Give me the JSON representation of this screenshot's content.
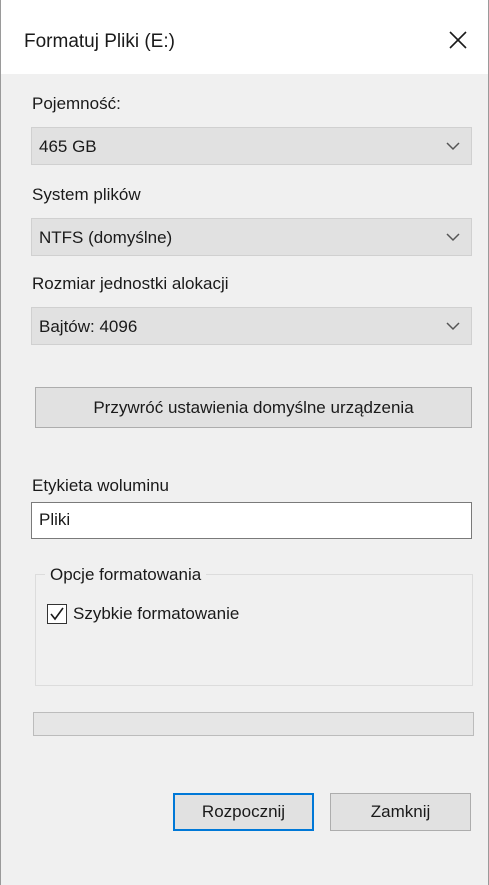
{
  "window": {
    "title": "Formatuj Pliki (E:)",
    "close_icon": "close-icon"
  },
  "capacity": {
    "label": "Pojemność:",
    "value": "465 GB"
  },
  "file_system": {
    "label": "System plików",
    "value": "NTFS (domyślne)"
  },
  "allocation_unit": {
    "label": "Rozmiar jednostki alokacji",
    "value": "Bajtów: 4096"
  },
  "restore_defaults_button": "Przywróć ustawienia domyślne urządzenia",
  "volume_label": {
    "label": "Etykieta woluminu",
    "value": "Pliki"
  },
  "format_options": {
    "legend": "Opcje formatowania",
    "quick_format_label": "Szybkie formatowanie",
    "quick_format_checked": true
  },
  "progress": {
    "fraction": 0
  },
  "buttons": {
    "start": "Rozpocznij",
    "close": "Zamknij"
  },
  "colors": {
    "accent": "#0078d7",
    "progress": "#06b025"
  }
}
